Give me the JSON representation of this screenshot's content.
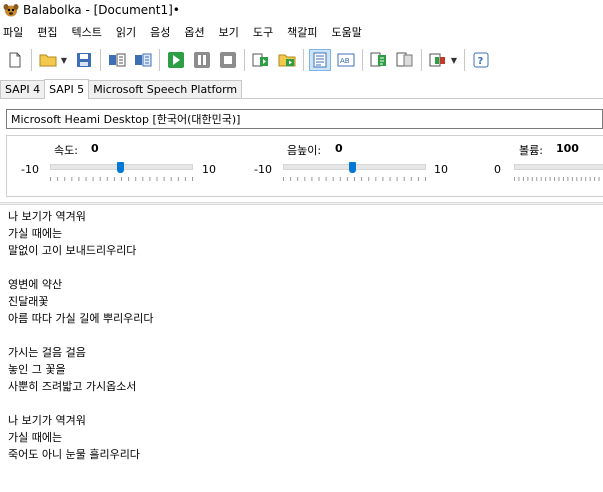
{
  "window": {
    "title": "Balabolka - [Document1]•"
  },
  "menu": [
    "파일",
    "편집",
    "텍스트",
    "읽기",
    "음성",
    "옵션",
    "보기",
    "도구",
    "책갈피",
    "도움말"
  ],
  "toolbar": {
    "buttons": [
      "new-file-icon",
      "open-folder-icon",
      "save-icon",
      "convert-file-icon",
      "batch-convert-icon",
      "play-icon",
      "pause-icon",
      "stop-icon",
      "speak-clipboard-icon",
      "read-folder-icon",
      "text-view-icon",
      "dictionary-icon",
      "read-selection-icon",
      "export-clipboard-icon",
      "audio-file-icon",
      "help-icon"
    ],
    "pressed": "text-view-icon"
  },
  "tabs": [
    "SAPI 4",
    "SAPI 5",
    "Microsoft Speech Platform"
  ],
  "active_tab": "SAPI 5",
  "voice": {
    "selected": "Microsoft Heami Desktop [한국어(대한민국)]"
  },
  "params": {
    "rate": {
      "label": "속도:",
      "value": "0",
      "min": "-10",
      "max": "10",
      "level": 0.5
    },
    "pitch": {
      "label": "음높이:",
      "value": "0",
      "min": "-10",
      "max": "10",
      "level": 0.5
    },
    "volume": {
      "label": "볼륨:",
      "value": "100",
      "min": "0"
    }
  },
  "text_lines": [
    "나 보기가 역겨워",
    "가실 때에는",
    "말없이 고이 보내드리우리다",
    "",
    "영변에 약산",
    "진달래꽃",
    "아름 따다 가실 길에 뿌리우리다",
    "",
    "가시는 걸음 걸음",
    "놓인 그 꽃을",
    "사뿐히 즈려밟고 가시옵소서",
    "",
    "나 보기가 역겨워",
    "가실 때에는",
    "죽어도 아니 눈물 흘리우리다"
  ],
  "colors": {
    "accent": "#0078d7",
    "pressed_bg": "#cce4f7"
  }
}
